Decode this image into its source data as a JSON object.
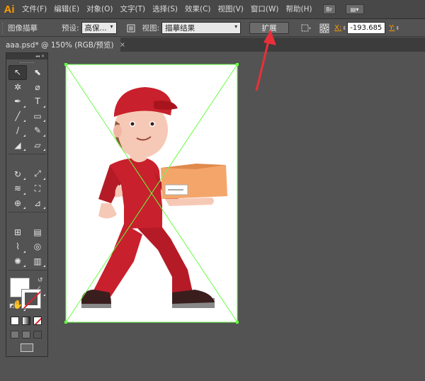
{
  "app": {
    "logo": "Ai"
  },
  "menu": {
    "items": [
      {
        "label": "文件(F)"
      },
      {
        "label": "编辑(E)"
      },
      {
        "label": "对象(O)"
      },
      {
        "label": "文字(T)"
      },
      {
        "label": "选择(S)"
      },
      {
        "label": "效果(C)"
      },
      {
        "label": "视图(V)"
      },
      {
        "label": "窗口(W)"
      },
      {
        "label": "帮助(H)"
      }
    ],
    "bridge_label": "Br",
    "arrange_label": "▤▾"
  },
  "controlbar": {
    "panel_label": "图像描摹",
    "preset_label": "预设:",
    "preset_value": "高保...",
    "view_label": "视图:",
    "view_value": "描摹结果",
    "expand_label": "扩展",
    "x_label": "X:",
    "x_value": "-193.685",
    "y_label": "Y:"
  },
  "document": {
    "tab_label": "aaa.psd* @ 150% (RGB/预览)",
    "close_label": "×"
  },
  "toolbox": {
    "collapse_label": "◂◂ ✕",
    "tools": [
      {
        "name": "selection-tool",
        "glyph": "↖"
      },
      {
        "name": "direct-selection-tool",
        "glyph": "⬉"
      },
      {
        "name": "magic-wand-tool",
        "glyph": "✲"
      },
      {
        "name": "lasso-tool",
        "glyph": "⌀"
      },
      {
        "name": "pen-tool",
        "glyph": "✒"
      },
      {
        "name": "type-tool",
        "glyph": "T"
      },
      {
        "name": "line-tool",
        "glyph": "╱"
      },
      {
        "name": "rectangle-tool",
        "glyph": "▭"
      },
      {
        "name": "paintbrush-tool",
        "glyph": "∕"
      },
      {
        "name": "pencil-tool",
        "glyph": "✎"
      },
      {
        "name": "blob-brush-tool",
        "glyph": "◢"
      },
      {
        "name": "eraser-tool",
        "glyph": "▱"
      },
      {
        "name": "rotate-tool",
        "glyph": "↻"
      },
      {
        "name": "scale-tool",
        "glyph": "⤢"
      },
      {
        "name": "warp-tool",
        "glyph": "≋"
      },
      {
        "name": "free-transform-tool",
        "glyph": "⛶"
      },
      {
        "name": "shape-builder-tool",
        "glyph": "⊕"
      },
      {
        "name": "perspective-grid-tool",
        "glyph": "⊿"
      },
      {
        "name": "mesh-tool",
        "glyph": "⊞"
      },
      {
        "name": "gradient-tool",
        "glyph": "▤"
      },
      {
        "name": "eyedropper-tool",
        "glyph": "⌇"
      },
      {
        "name": "blend-tool",
        "glyph": "◎"
      },
      {
        "name": "symbol-sprayer-tool",
        "glyph": "✺"
      },
      {
        "name": "column-graph-tool",
        "glyph": "▥"
      },
      {
        "name": "artboard-tool",
        "glyph": "⌗"
      },
      {
        "name": "slice-tool",
        "glyph": "⟋"
      },
      {
        "name": "hand-tool",
        "glyph": "✋"
      },
      {
        "name": "zoom-tool",
        "glyph": "⚲"
      }
    ],
    "swap_label": "↺",
    "default_label": "◩"
  },
  "colors": {
    "accent": "#ff9a00",
    "bounding_box": "#66ff44",
    "arrow": "#e8303a",
    "shirt": "#c8202c",
    "box": "#f4a66a"
  }
}
